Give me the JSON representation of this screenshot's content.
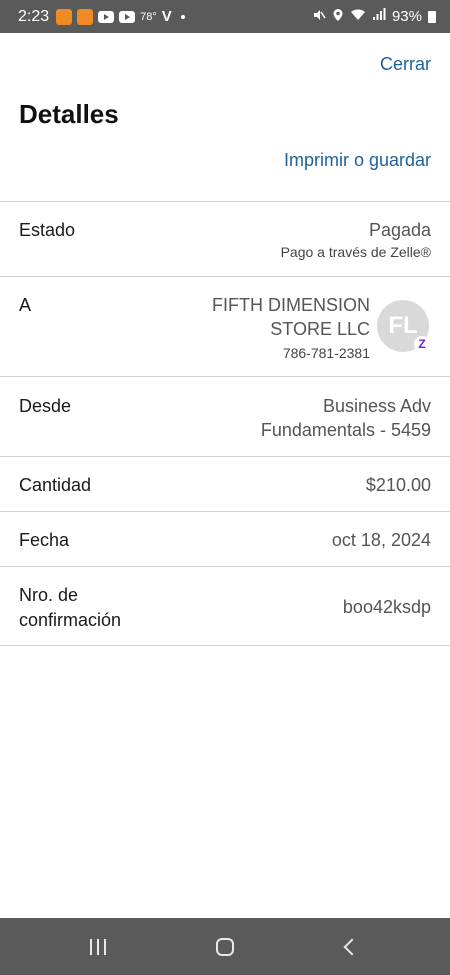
{
  "status_bar": {
    "time": "2:23",
    "temperature": "78°",
    "carrier_icon": "V",
    "battery": "93%"
  },
  "header": {
    "close_label": "Cerrar",
    "title": "Detalles",
    "print_label": "Imprimir o guardar"
  },
  "details": {
    "estado": {
      "label": "Estado",
      "value": "Pagada",
      "sub": "Pago a través de Zelle®"
    },
    "a": {
      "label": "A",
      "name_line1": "FIFTH DIMENSION",
      "name_line2": "STORE LLC",
      "phone": "786-781-2381",
      "avatar_initials": "FL",
      "badge": "Z"
    },
    "desde": {
      "label": "Desde",
      "value_line1": "Business Adv",
      "value_line2": "Fundamentals - 5459"
    },
    "cantidad": {
      "label": "Cantidad",
      "value": "$210.00"
    },
    "fecha": {
      "label": "Fecha",
      "value": "oct 18, 2024"
    },
    "confirmacion": {
      "label_line1": "Nro. de",
      "label_line2": "confirmación",
      "value": "boo42ksdp"
    }
  },
  "colors": {
    "link": "#1f5f9e",
    "status_bar": "#5a5a5a",
    "zelle": "#6d1ed4"
  },
  "icons": [
    "app-icon",
    "youtube-icon",
    "mute-icon",
    "location-icon",
    "wifi-icon",
    "signal-icon",
    "battery-icon",
    "recents-icon",
    "home-icon",
    "back-icon"
  ]
}
